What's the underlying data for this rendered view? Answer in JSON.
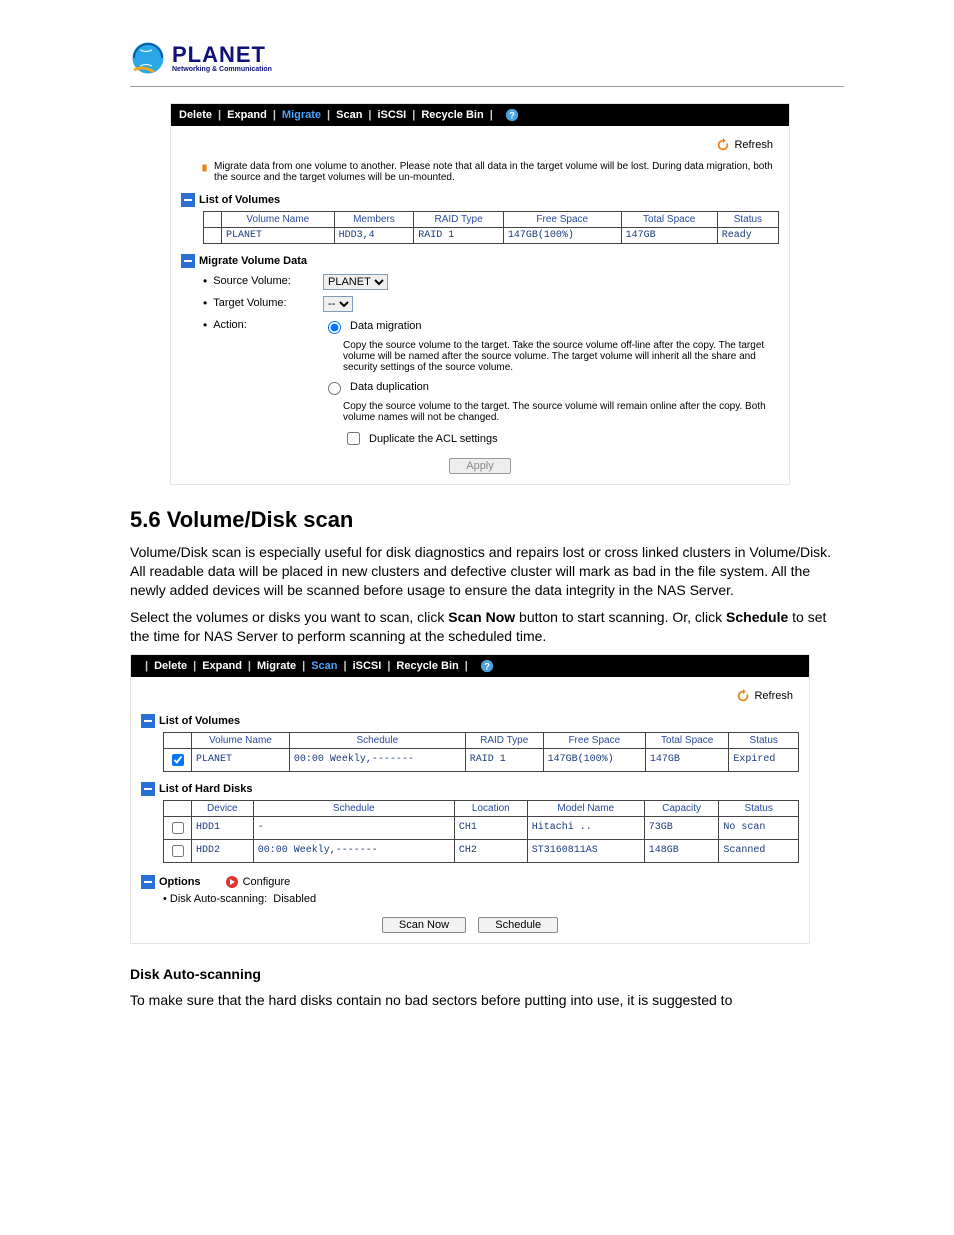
{
  "logo": {
    "brand": "PLANET",
    "tag": "Networking & Communication"
  },
  "toolbar": {
    "items": [
      "Delete",
      "Expand",
      "Migrate",
      "Scan",
      "iSCSI",
      "Recycle Bin"
    ]
  },
  "refresh_label": "Refresh",
  "migrate_panel": {
    "active_tab_index": 2,
    "note": "Migrate data from one volume to another. Please note that all data in the target volume will be lost. During data migration, both the source and the target volumes will be un-mounted.",
    "list_title": "List of Volumes",
    "headers": [
      "Volume Name",
      "Members",
      "RAID Type",
      "Free Space",
      "Total Space",
      "Status"
    ],
    "row": {
      "volume": "PLANET",
      "members": "HDD3,4",
      "raid": "RAID 1",
      "free": "147GB(100%)",
      "total": "147GB",
      "status": "Ready"
    },
    "form_title": "Migrate Volume Data",
    "labels": {
      "source": "Source Volume:",
      "target": "Target Volume:",
      "action": "Action:"
    },
    "source_value": "PLANET",
    "target_value": "--",
    "radios": {
      "migration_label": "Data migration",
      "migration_desc": "Copy the source volume to the target. Take the source volume off-line after the copy. The target volume will be named after the source volume. The target volume will inherit all the share and security settings of the source volume.",
      "duplication_label": "Data duplication",
      "duplication_desc": "Copy the source volume to the target. The source volume will remain online after the copy. Both volume names will not be changed.",
      "acl_label": "Duplicate the ACL settings"
    },
    "apply_label": "Apply"
  },
  "section": {
    "heading": "5.6 Volume/Disk scan",
    "para1": "Volume/Disk scan is especially useful for disk diagnostics and repairs lost or cross linked clusters in Volume/Disk. All readable data will be placed in new clusters and defective cluster will mark as bad in the file system. All the newly added devices will be scanned before usage to ensure the data integrity in the NAS Server.",
    "para2_pre": "Select the volumes or disks you want to scan, click ",
    "para2_b1": "Scan Now",
    "para2_mid": " button to start scanning. Or, click ",
    "para2_b2": "Schedule",
    "para2_post": " to set the time for NAS Server to perform scanning at the scheduled time."
  },
  "scan_panel": {
    "active_tab_index": 3,
    "volumes_title": "List of Volumes",
    "vol_headers": [
      "Volume Name",
      "Schedule",
      "RAID Type",
      "Free Space",
      "Total Space",
      "Status"
    ],
    "vol_row": {
      "checked": true,
      "name": "PLANET",
      "schedule": "00:00 Weekly,-------",
      "raid": "RAID 1",
      "free": "147GB(100%)",
      "total": "147GB",
      "status": "Expired"
    },
    "disks_title": "List of Hard Disks",
    "disk_headers": [
      "Device",
      "Schedule",
      "Location",
      "Model Name",
      "Capacity",
      "Status"
    ],
    "disk_rows": [
      {
        "checked": false,
        "device": "HDD1",
        "schedule": "-",
        "location": "CH1",
        "model": "Hitachi ..",
        "capacity": "73GB",
        "status": "No scan"
      },
      {
        "checked": false,
        "device": "HDD2",
        "schedule": "00:00 Weekly,-------",
        "location": "CH2",
        "model": "ST3160811AS",
        "capacity": "148GB",
        "status": "Scanned"
      }
    ],
    "options_title": "Options",
    "configure_label": "Configure",
    "autoscan_label": "Disk Auto-scanning:",
    "autoscan_value": "Disabled",
    "scan_now_label": "Scan Now",
    "schedule_label": "Schedule"
  },
  "footer": {
    "heading": "Disk Auto-scanning",
    "para": "To make sure that the hard disks contain no bad sectors before putting into use, it is suggested to"
  }
}
